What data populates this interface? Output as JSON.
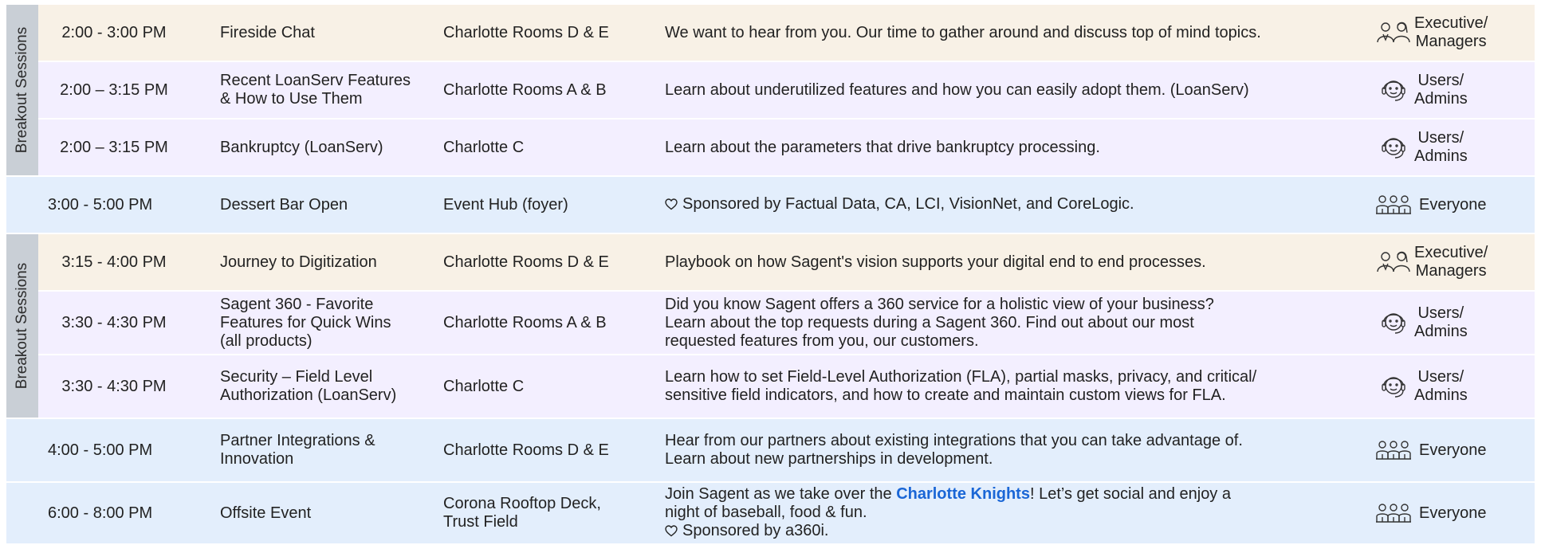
{
  "sections": [
    {
      "label": "Breakout Sessions"
    },
    {
      "label": "Breakout Sessions"
    }
  ],
  "rows": [
    {
      "time": "2:00 - 3:00 PM",
      "title": "Fireside Chat",
      "room": "Charlotte Rooms D & E",
      "desc": "We want to hear from you. Our time to gather around and discuss top of mind topics.",
      "aud1": "Executive/",
      "aud2": "Managers"
    },
    {
      "time": "2:00 – 3:15 PM",
      "title1": "Recent LoanServ Features",
      "title2": "& How to Use Them",
      "room": "Charlotte Rooms A & B",
      "desc": "Learn about underutilized features and how you can easily adopt them. (LoanServ)",
      "aud1": "Users/",
      "aud2": "Admins"
    },
    {
      "time": "2:00 – 3:15 PM",
      "title": "Bankruptcy (LoanServ)",
      "room": "Charlotte C",
      "desc": "Learn about the parameters that drive bankruptcy processing.",
      "aud1": "Users/",
      "aud2": "Admins"
    },
    {
      "time": "3:00 - 5:00 PM",
      "title": "Dessert Bar Open",
      "room": "Event Hub (foyer)",
      "desc": "Sponsored by Factual Data, CA, LCI, VisionNet, and CoreLogic.",
      "aud": "Everyone"
    },
    {
      "time": "3:15 - 4:00 PM",
      "title": "Journey to Digitization",
      "room": "Charlotte Rooms D & E",
      "desc": "Playbook on how Sagent's vision supports your digital end to end processes.",
      "aud1": "Executive/",
      "aud2": "Managers"
    },
    {
      "time": "3:30 - 4:30 PM",
      "title1": "Sagent 360 - Favorite",
      "title2": "Features for Quick Wins",
      "title3": "(all products)",
      "room": "Charlotte Rooms A & B",
      "desc1": "Did you know Sagent offers a 360 service for a holistic view of your business?",
      "desc2": "Learn about the top requests during a Sagent 360. Find out about our most",
      "desc3": "requested features from you, our customers.",
      "aud1": "Users/",
      "aud2": "Admins"
    },
    {
      "time": "3:30 - 4:30 PM",
      "title1": "Security – Field Level",
      "title2": "Authorization (LoanServ)",
      "room": "Charlotte C",
      "desc1": "Learn how to set Field-Level Authorization (FLA), partial masks, privacy, and critical/",
      "desc2": "sensitive field indicators, and how to create and maintain custom views for FLA.",
      "aud1": "Users/",
      "aud2": "Admins"
    },
    {
      "time": "4:00 - 5:00 PM",
      "title1": "Partner Integrations &",
      "title2": "Innovation",
      "room": "Charlotte Rooms D & E",
      "desc1": "Hear from our partners about existing integrations that you can take advantage of.",
      "desc2": "Learn about new partnerships in development.",
      "aud": "Everyone"
    },
    {
      "time": "6:00 - 8:00 PM",
      "title": "Offsite Event",
      "room1": "Corona Rooftop Deck,",
      "room2": "Trust Field",
      "desc_pre": "Join Sagent as we take over the ",
      "desc_link": "Charlotte Knights",
      "desc_post": "! Let’s get social and enjoy a",
      "desc2": "night of baseball, food & fun.",
      "desc3": "Sponsored by a360i.",
      "aud": "Everyone"
    }
  ],
  "colors": {
    "executive": "#f8f1e6",
    "users": "#f3efff",
    "everyone": "#e3eefc",
    "band": "#c9cfd6",
    "link": "#1a66d6"
  },
  "icons": {
    "executive": "executive-managers-icon",
    "users": "headset-user-icon",
    "everyone": "group-icon",
    "sponsor": "heart-icon"
  }
}
